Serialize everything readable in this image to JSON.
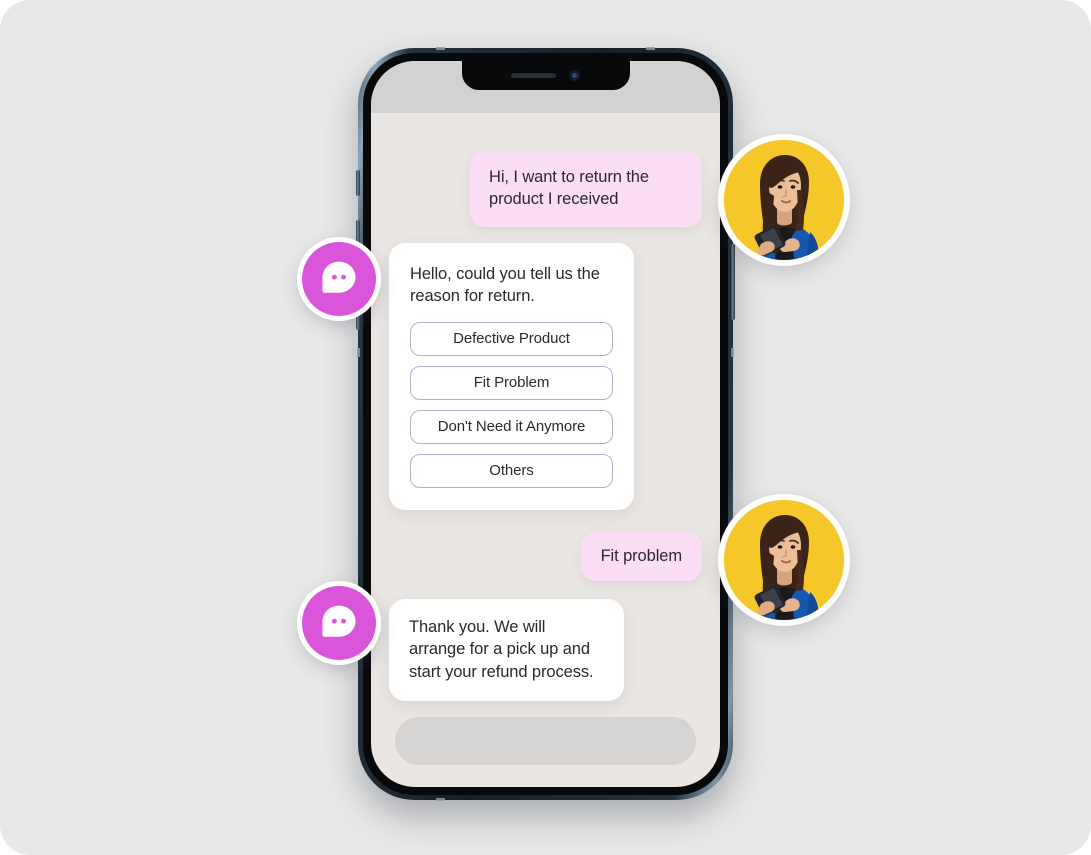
{
  "page": {
    "background_color": "#E8E8E8",
    "title": "Chatbot product return conversation mockup"
  },
  "phone": {
    "frame_color": "#16202a",
    "screen_background": "#EAE6E3",
    "status_band_color": "#D2D2D2",
    "notch": {
      "speaker_icon": "speaker-slit-icon",
      "camera_icon": "front-camera-icon"
    },
    "buttons": {
      "mute_switch": "mute-switch",
      "volume_up": "volume-up-button",
      "volume_down": "volume-down-button",
      "power": "power-button"
    }
  },
  "chat": {
    "accent_user_bubble": "#FBDDF5",
    "accent_bot_bubble": "#FFFFFF",
    "accent_badge": "#DA55DA",
    "messages": [
      {
        "sender": "user",
        "type": "text",
        "text": "Hi, I want to return the product I received"
      },
      {
        "sender": "bot",
        "type": "options",
        "text": "Hello, could you tell us the reason for return.",
        "options": [
          "Defective Product",
          "Fit Problem",
          "Don't Need it Anymore",
          "Others"
        ]
      },
      {
        "sender": "user",
        "type": "text",
        "text": "Fit problem"
      },
      {
        "sender": "bot",
        "type": "text",
        "text": "Thank you. We will arrange for a pick up and start your refund process."
      }
    ],
    "composer": {
      "value": "",
      "placeholder": ""
    }
  },
  "badges": {
    "bot_icon_name": "chat-bubble-dots-icon",
    "bot_icon_color": "#DA55DA",
    "avatar_name": "woman-using-phone-avatar",
    "avatar_background": "#F6C728"
  }
}
